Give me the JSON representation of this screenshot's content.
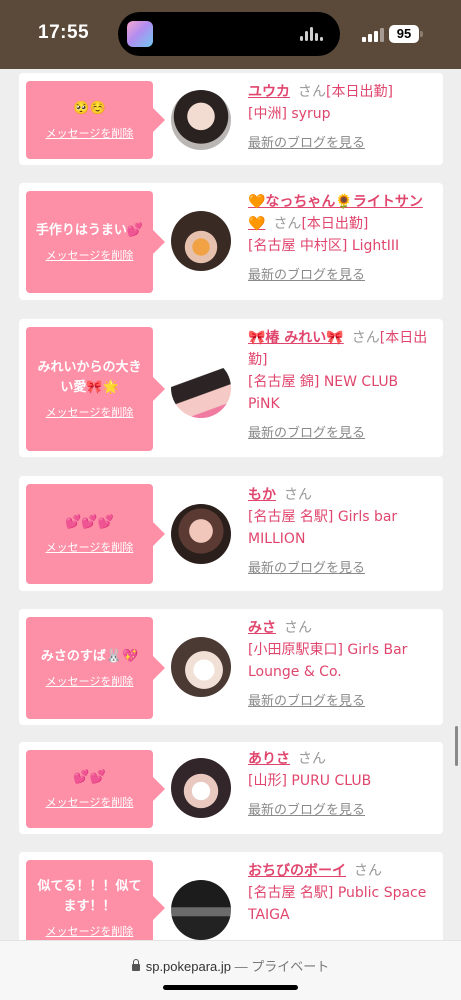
{
  "status_bar": {
    "time": "17:55",
    "battery": "95"
  },
  "messages": [
    {
      "message": "🥺☺️",
      "delete_label": "メッセージを削除",
      "name": "ユウカ",
      "honorific": "さん",
      "status": "[本日出勤]",
      "shop": "[中洲] syrup",
      "blog_label": "最新のブログを見る"
    },
    {
      "message": "手作りはうまい💕",
      "delete_label": "メッセージを削除",
      "name": "🧡なっちゃん🌻ライトサン🧡",
      "honorific": "さん",
      "status": "[本日出勤]",
      "shop": "[名古屋 中村区] LightIII",
      "blog_label": "最新のブログを見る"
    },
    {
      "message": "みれいからの大きい愛🎀🌟",
      "delete_label": "メッセージを削除",
      "name": "🎀椿 みれい🎀",
      "honorific": "さん",
      "status": "[本日出勤]",
      "shop": "[名古屋 錦] NEW CLUB PiNK",
      "blog_label": "最新のブログを見る"
    },
    {
      "message": "💕💕💕",
      "delete_label": "メッセージを削除",
      "name": "もか",
      "honorific": "さん",
      "status": "",
      "shop": "[名古屋 名駅] Girls bar MILLION",
      "blog_label": "最新のブログを見る"
    },
    {
      "message": "みさのすば🐰💖",
      "delete_label": "メッセージを削除",
      "name": "みさ",
      "honorific": "さん",
      "status": "",
      "shop": "[小田原駅東口] Girls Bar Lounge & Co.",
      "blog_label": "最新のブログを見る"
    },
    {
      "message": "💕💕",
      "delete_label": "メッセージを削除",
      "name": "ありさ",
      "honorific": "さん",
      "status": "",
      "shop": "[山形] PURU CLUB",
      "blog_label": "最新のブログを見る"
    },
    {
      "message": "似てる！！！似てます！！",
      "delete_label": "メッセージを削除",
      "name": "おちびのボーイ",
      "honorific": "さん",
      "status": "",
      "shop": "[名古屋 名駅] Public Space TAIGA",
      "blog_label": ""
    }
  ],
  "browser": {
    "domain": "sp.pokepara.jp",
    "separator": "—",
    "mode": "プライベート"
  },
  "colors": {
    "accent": "#e0466d",
    "bubble": "#fd8fa6",
    "status_bar": "#5b4a39",
    "page_bg": "#eeeeee"
  }
}
